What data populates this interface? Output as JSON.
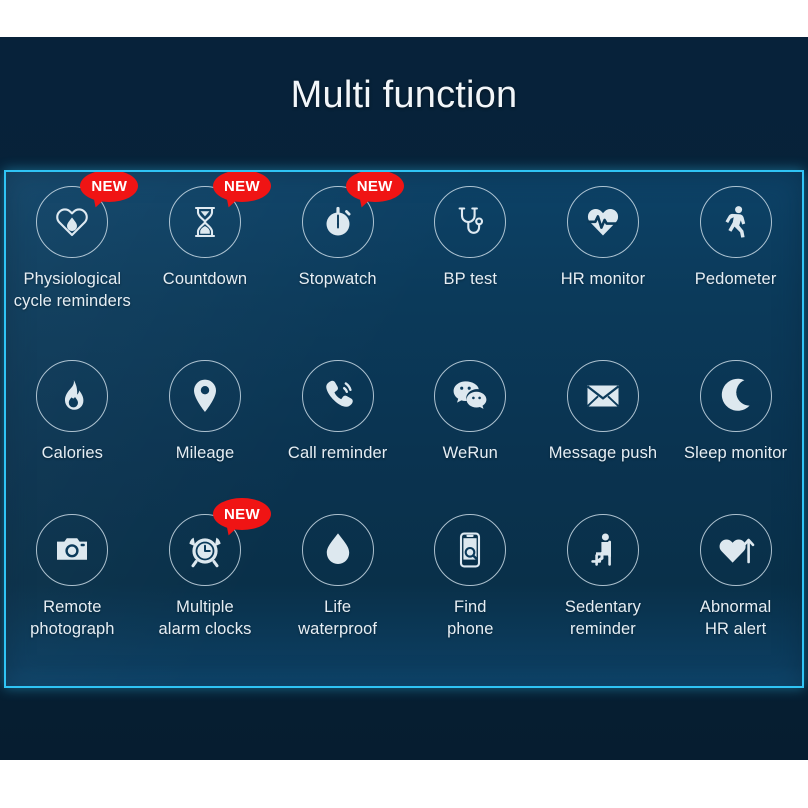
{
  "header": {
    "title": "Multi function"
  },
  "colors": {
    "page_background": "#ffffff",
    "backdrop": "#07223a",
    "panel_top": "#0d4267",
    "panel_bottom": "#0f4a72",
    "panel_border": "#2fc4f5",
    "badge_red": "#f01414",
    "icon_stroke": "#d6e5ef",
    "label_text": "#e6eef4"
  },
  "badge": {
    "label": "NEW"
  },
  "features": [
    [
      {
        "id": "physiological-cycle-reminders",
        "label": "Physiological\ncycle reminders",
        "icon": "heart-droplet-icon",
        "badge": true
      },
      {
        "id": "countdown",
        "label": "Countdown",
        "icon": "hourglass-icon",
        "badge": true
      },
      {
        "id": "stopwatch",
        "label": "Stopwatch",
        "icon": "stopwatch-icon",
        "badge": true
      },
      {
        "id": "bp-test",
        "label": "BP test",
        "icon": "stethoscope-icon",
        "badge": false
      },
      {
        "id": "hr-monitor",
        "label": "HR monitor",
        "icon": "heart-pulse-icon",
        "badge": false
      },
      {
        "id": "pedometer",
        "label": "Pedometer",
        "icon": "walking-person-icon",
        "badge": false
      }
    ],
    [
      {
        "id": "calories",
        "label": "Calories",
        "icon": "flame-icon",
        "badge": false
      },
      {
        "id": "mileage",
        "label": "Mileage",
        "icon": "map-pin-icon",
        "badge": false
      },
      {
        "id": "call-reminder",
        "label": "Call reminder",
        "icon": "ringing-phone-icon",
        "badge": false
      },
      {
        "id": "werun",
        "label": "WeRun",
        "icon": "wechat-bubbles-icon",
        "badge": false
      },
      {
        "id": "message-push",
        "label": "Message push",
        "icon": "envelope-icon",
        "badge": false
      },
      {
        "id": "sleep-monitor",
        "label": "Sleep monitor",
        "icon": "moon-stars-icon",
        "badge": false
      }
    ],
    [
      {
        "id": "remote-photograph",
        "label": "Remote\nphotograph",
        "icon": "camera-icon",
        "badge": false
      },
      {
        "id": "multiple-alarm-clocks",
        "label": "Multiple\nalarm clocks",
        "icon": "alarm-clock-icon",
        "badge": true
      },
      {
        "id": "life-waterproof",
        "label": "Life\nwaterproof",
        "icon": "water-drop-icon",
        "badge": false
      },
      {
        "id": "find-phone",
        "label": "Find\nphone",
        "icon": "phone-search-icon",
        "badge": false
      },
      {
        "id": "sedentary-reminder",
        "label": "Sedentary\nreminder",
        "icon": "sitting-person-icon",
        "badge": false
      },
      {
        "id": "abnormal-hr-alert",
        "label": "Abnormal\nHR alert",
        "icon": "heart-arrow-up-icon",
        "badge": false
      }
    ]
  ]
}
